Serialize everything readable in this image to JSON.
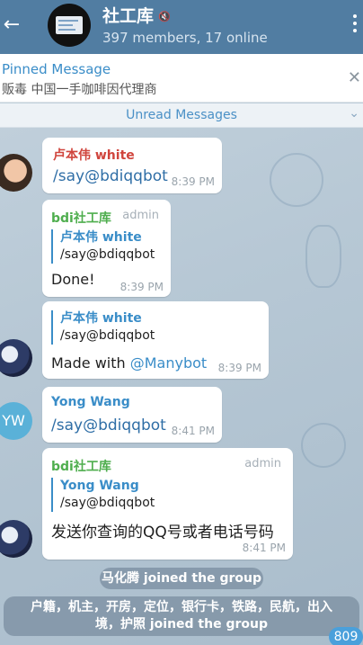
{
  "header": {
    "back_icon": "arrow-left-icon",
    "title": "社工库",
    "mute_icon": "speaker-muted-icon",
    "subtitle": "397 members, 17 online",
    "menu_icon": "more-vertical-icon"
  },
  "pinned": {
    "title": "Pinned Message",
    "text": "贩毒   中国一手咖啡因代理商",
    "close_icon": "close-icon"
  },
  "unread_banner": {
    "label": "Unread Messages",
    "chevron_icon": "chevron-down-icon"
  },
  "messages": [
    {
      "sender": "卢本伟 white",
      "text": "/say@bdiqqbot",
      "time": "8:39 PM"
    },
    {
      "sender": "bdi社工库",
      "tag": "admin",
      "reply_name": "卢本伟 white",
      "reply_text": "/say@bdiqqbot",
      "text": "Done!",
      "time": "8:39 PM"
    },
    {
      "reply_name": "卢本伟 white",
      "reply_text": "/say@bdiqqbot",
      "text_prefix": "Made with ",
      "link": "@Manybot",
      "time": "8:39 PM"
    },
    {
      "sender": "Yong Wang",
      "text": "/say@bdiqqbot",
      "time": "8:41 PM",
      "avatar_initials": "YW"
    },
    {
      "sender": "bdi社工库",
      "tag": "admin",
      "reply_name": "Yong Wang",
      "reply_text": "/say@bdiqqbot",
      "text": "发送你查询的QQ号或者电话号码",
      "time": "8:41 PM"
    }
  ],
  "service": [
    {
      "text": "马化腾 joined the group"
    },
    {
      "line1": "户籍，机主，开房，定位，银行卡，铁路，民航，出入",
      "line2": "境，护照 joined the group"
    }
  ],
  "unread_count": "809",
  "colors": {
    "header": "#517da2",
    "accent": "#3a8dc8",
    "admin_green": "#4fae4e",
    "sender_red": "#d0453d"
  }
}
